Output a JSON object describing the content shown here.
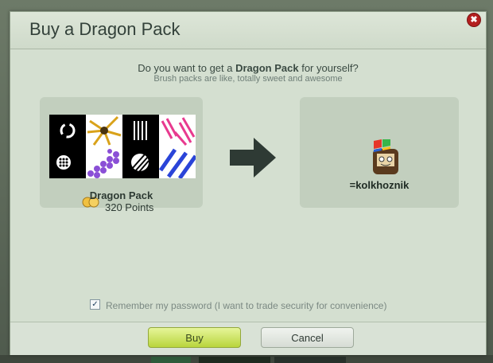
{
  "dialog": {
    "title": "Buy a Dragon Pack",
    "close_glyph": "✖",
    "question_prefix": "Do you want to get a ",
    "question_bold": "Dragon Pack",
    "question_suffix": " for yourself?",
    "subtitle": "Brush packs are like, totally sweet and awesome"
  },
  "pack": {
    "name": "Dragon Pack",
    "points": "320 Points",
    "coin_icon": "points-coins-icon"
  },
  "recipient": {
    "username": "=kolkhoznik",
    "avatar_icon": "user-avatar-icon"
  },
  "remember": {
    "checked": true,
    "label": "Remember my password (I want to trade security for convenience)"
  },
  "buttons": {
    "buy": "Buy",
    "cancel": "Cancel"
  },
  "colors": {
    "buy_button": "#c9e05a",
    "panel": "#c2cfbe",
    "dialog_bg": "#d4dfd0",
    "close": "#b41f1f"
  }
}
